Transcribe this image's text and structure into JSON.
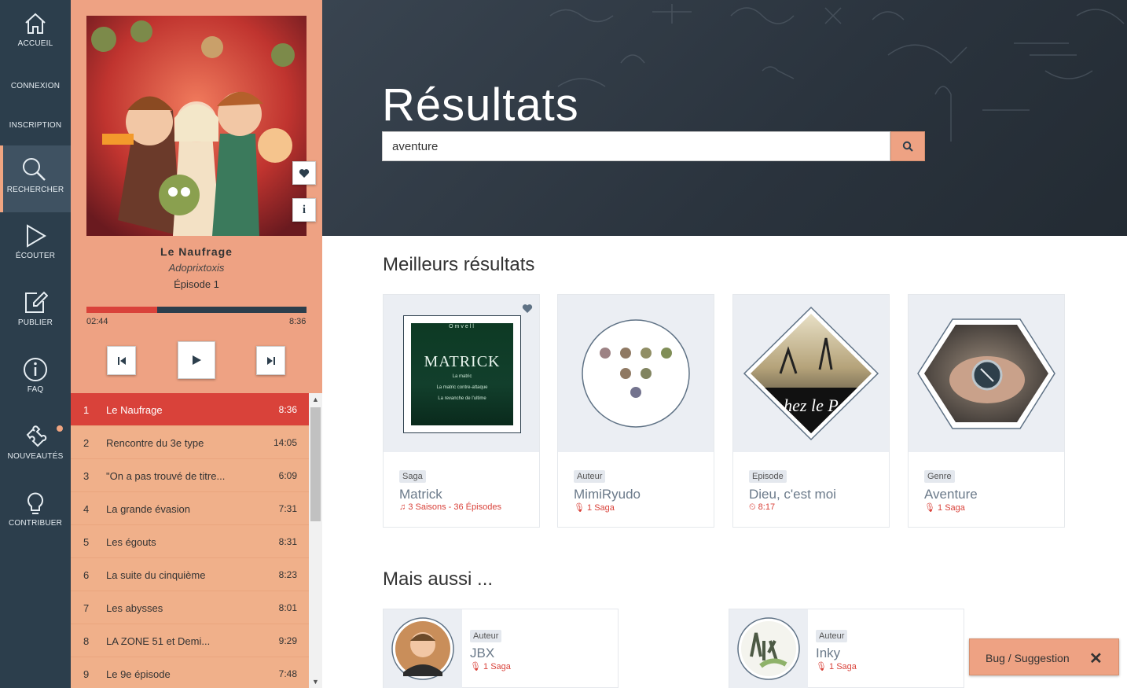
{
  "nav": {
    "items": [
      {
        "label": "ACCUEIL",
        "icon": "home-icon"
      },
      {
        "label": "CONNEXION",
        "icon": ""
      },
      {
        "label": "INSCRIPTION",
        "icon": ""
      },
      {
        "label": "RECHERCHER",
        "icon": "search-icon",
        "active": true
      },
      {
        "label": "ÉCOUTER",
        "icon": "play-icon"
      },
      {
        "label": "PUBLIER",
        "icon": "edit-icon"
      },
      {
        "label": "FAQ",
        "icon": "info-icon"
      },
      {
        "label": "NOUVEAUTÉS",
        "icon": "puzzle-icon"
      },
      {
        "label": "CONTRIBUER",
        "icon": "lightbulb-icon"
      }
    ]
  },
  "player": {
    "title": "Le Naufrage",
    "artist": "Adoprixtoxis",
    "episode": "Épisode 1",
    "current_time": "02:44",
    "total_time": "8:36",
    "progress": 0.32
  },
  "playlist": [
    {
      "num": "1",
      "name": "Le Naufrage",
      "dur": "8:36"
    },
    {
      "num": "2",
      "name": "Rencontre du 3e type",
      "dur": "14:05"
    },
    {
      "num": "3",
      "name": "\"On a pas trouvé de titre...",
      "dur": "6:09"
    },
    {
      "num": "4",
      "name": "La grande évasion",
      "dur": "7:31"
    },
    {
      "num": "5",
      "name": "Les égouts",
      "dur": "8:31"
    },
    {
      "num": "6",
      "name": "La suite du cinquième",
      "dur": "8:23"
    },
    {
      "num": "7",
      "name": "Les abysses",
      "dur": "8:01"
    },
    {
      "num": "8",
      "name": "LA ZONE 51 et Demi...",
      "dur": "9:29"
    },
    {
      "num": "9",
      "name": "Le 9e épisode",
      "dur": "7:48"
    }
  ],
  "header": {
    "title": "Résultats",
    "search_value": "aventure"
  },
  "best": {
    "title": "Meilleurs résultats",
    "cards": [
      {
        "tag": "Saga",
        "name": "Matrick",
        "sub": "3 Saisons - 36 Épisodes",
        "cover_top": "Omvell",
        "cover_name": "MATRICK",
        "cover_line1": "La matric",
        "cover_line2": "La matric contre-attaque",
        "cover_line3": "La revanche de l'ultime"
      },
      {
        "tag": "Auteur",
        "name": "MimiRyudo",
        "sub": "1 Saga"
      },
      {
        "tag": "Episode",
        "name": "Dieu, c'est moi",
        "sub": "8:17",
        "cover_text": "hez le P"
      },
      {
        "tag": "Genre",
        "name": "Aventure",
        "sub": "1 Saga"
      }
    ]
  },
  "also": {
    "title": "Mais aussi ...",
    "items": [
      {
        "tag": "Auteur",
        "name": "JBX",
        "sub": "1 Saga"
      },
      {
        "tag": "Auteur",
        "name": "Inky",
        "sub": "1 Saga"
      }
    ]
  },
  "bug": {
    "label": "Bug / Suggestion",
    "close": "✕"
  }
}
